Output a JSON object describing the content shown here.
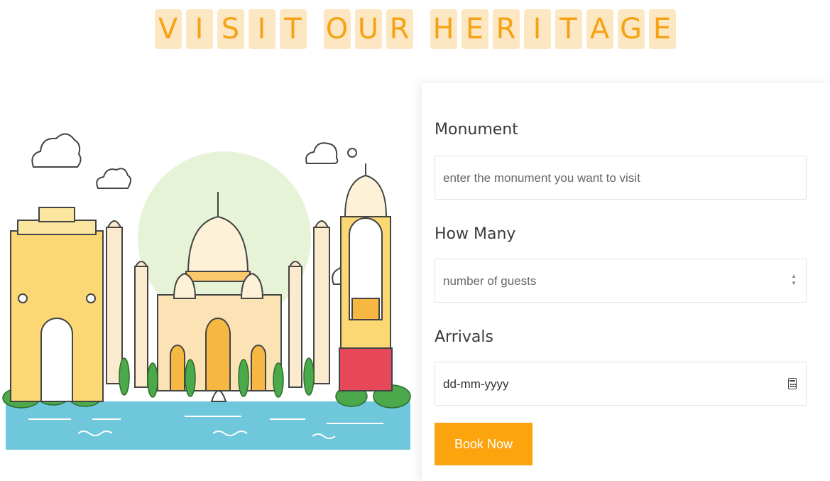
{
  "header": {
    "words": [
      [
        "V",
        "I",
        "S",
        "I",
        "T"
      ],
      [
        "O",
        "U",
        "R"
      ],
      [
        "H",
        "E",
        "R",
        "I",
        "T",
        "A",
        "G",
        "E"
      ]
    ]
  },
  "form": {
    "monument_label": "Monument",
    "monument_placeholder": "enter the monument you want to visit",
    "guests_label": "How Many",
    "guests_placeholder": "number of guests",
    "arrivals_label": "Arrivals",
    "arrivals_placeholder": "dd-mm-yyyy",
    "book_button": "Book Now"
  },
  "colors": {
    "accent": "#fba40e",
    "title_tile": "#fde7c3",
    "title_text": "#f5a316"
  },
  "icons": {
    "guests_spinner": "up-down-spinner-icon",
    "arrivals_picker": "calendar-icon"
  }
}
